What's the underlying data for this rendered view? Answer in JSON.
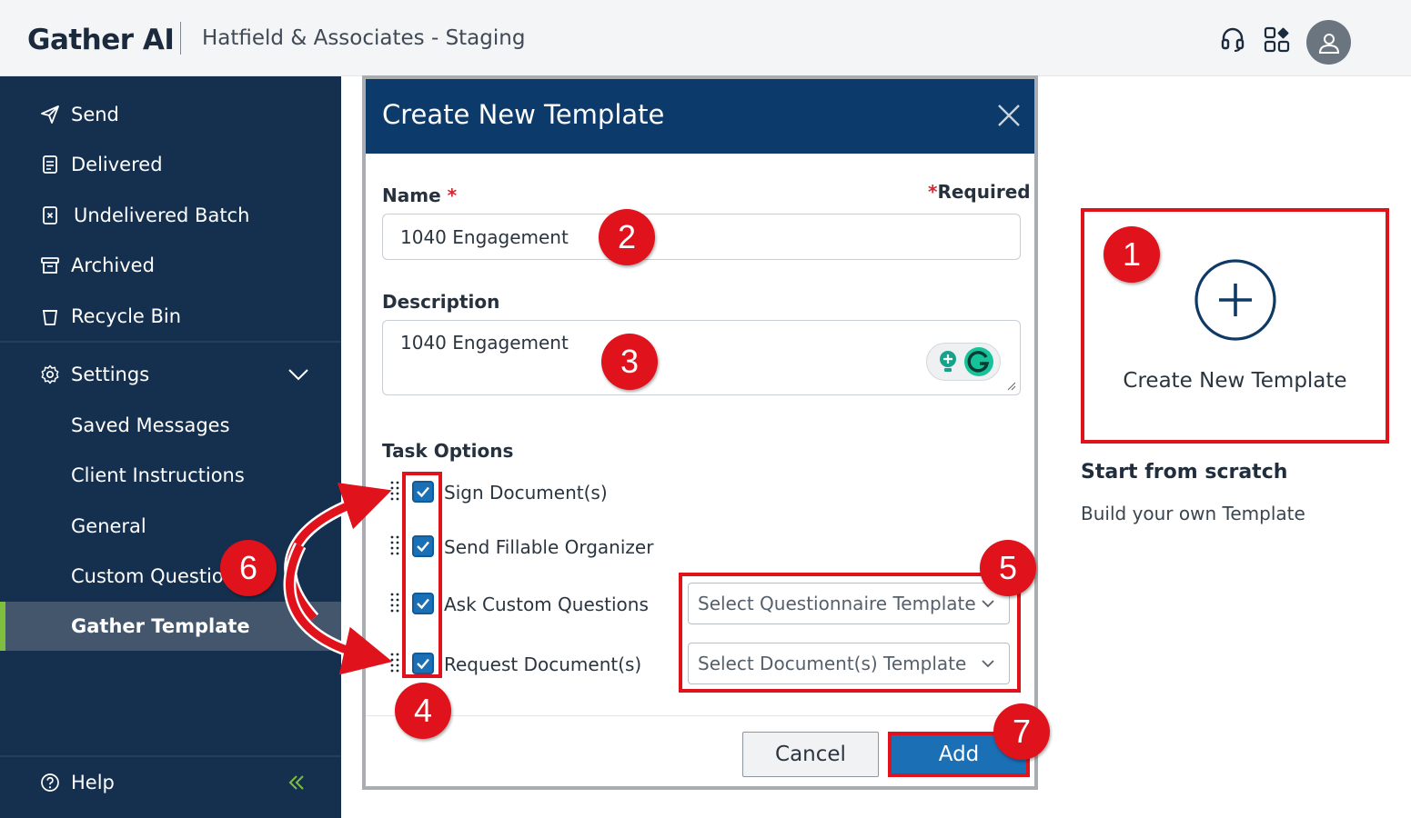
{
  "header": {
    "brand": "Gather AI",
    "org": "Hatfield & Associates - Staging"
  },
  "sidebar": {
    "items": [
      {
        "label": "Send",
        "icon": "send-icon"
      },
      {
        "label": "Delivered",
        "icon": "document-icon"
      },
      {
        "label": "Undelivered Batch",
        "icon": "undelivered-icon"
      },
      {
        "label": "Archived",
        "icon": "archive-icon"
      },
      {
        "label": "Recycle Bin",
        "icon": "trash-icon"
      }
    ],
    "settings_label": "Settings",
    "sub_items": [
      {
        "label": "Saved Messages"
      },
      {
        "label": "Client Instructions"
      },
      {
        "label": "General"
      },
      {
        "label": "Custom Questions"
      },
      {
        "label": "Gather Template"
      }
    ],
    "help_label": "Help",
    "accent_color": "#7fbe3f"
  },
  "modal": {
    "title": "Create New Template",
    "name_label": "Name",
    "required_label": "Required",
    "name_value": "1040 Engagement",
    "description_label": "Description",
    "description_value": "1040 Engagement",
    "task_options_label": "Task Options",
    "tasks": [
      {
        "label": "Sign Document(s)",
        "checked": true
      },
      {
        "label": "Send Fillable Organizer",
        "checked": true
      },
      {
        "label": "Ask Custom Questions",
        "checked": true
      },
      {
        "label": "Request Document(s)",
        "checked": true
      }
    ],
    "questionnaire_select": "Select Questionnaire Template",
    "documents_select": "Select Document(s) Template",
    "cancel_label": "Cancel",
    "add_label": "Add"
  },
  "card": {
    "title": "Create New Template",
    "scratch_title": "Start from scratch",
    "scratch_sub": "Build your own Template"
  },
  "annotations": {
    "b1": "1",
    "b2": "2",
    "b3": "3",
    "b4": "4",
    "b5": "5",
    "b6": "6",
    "b7": "7",
    "color": "#e0121b"
  }
}
